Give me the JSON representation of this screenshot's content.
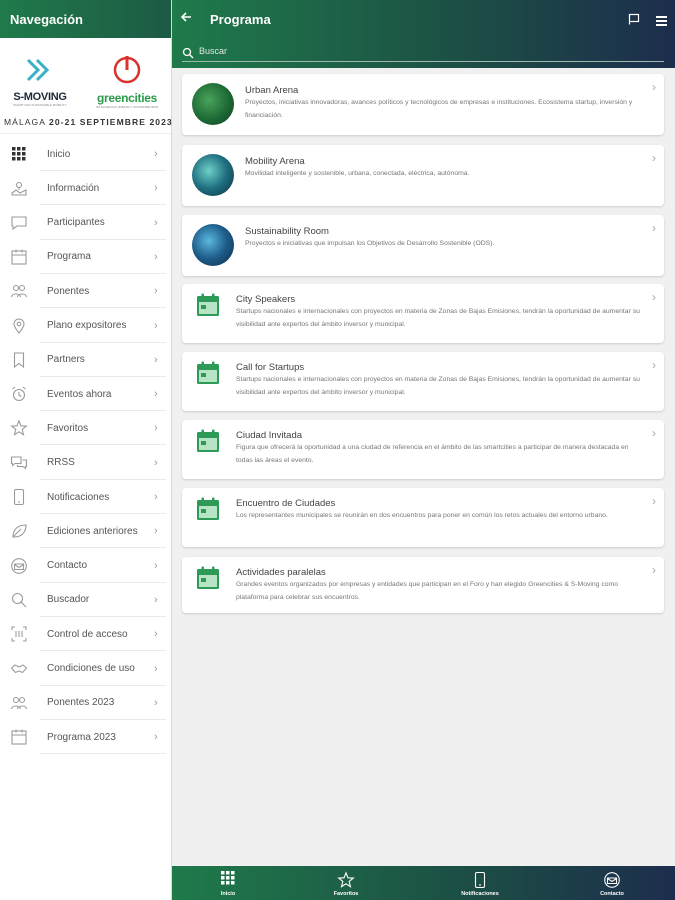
{
  "sidebar": {
    "title": "Navegación",
    "logos": {
      "smoving_name": "S-MOVING",
      "smoving_tagline": "SMART AND SUSTAINABLE MOBILITY",
      "greencities_name": "greencities",
      "greencities_tagline": "INTELIGENCIA URBANA Y SOSTENIBILIDAD",
      "event_city": "MÁLAGA",
      "event_dates": "20-21 SEPTIEMBRE 2023"
    },
    "items": [
      {
        "label": "Inicio",
        "icon": "grid-icon"
      },
      {
        "label": "Información",
        "icon": "map-icon"
      },
      {
        "label": "Participantes",
        "icon": "chat-icon"
      },
      {
        "label": "Programa",
        "icon": "calendar-icon"
      },
      {
        "label": "Ponentes",
        "icon": "people-icon"
      },
      {
        "label": "Plano expositores",
        "icon": "location-pin-icon"
      },
      {
        "label": "Partners",
        "icon": "bookmark-icon"
      },
      {
        "label": "Eventos ahora",
        "icon": "alarm-icon"
      },
      {
        "label": "Favoritos",
        "icon": "star-icon"
      },
      {
        "label": "RRSS",
        "icon": "chats-icon"
      },
      {
        "label": "Notificaciones",
        "icon": "phone-icon"
      },
      {
        "label": "Ediciones anteriores",
        "icon": "leaf-icon"
      },
      {
        "label": "Contacto",
        "icon": "mail-icon"
      },
      {
        "label": "Buscador",
        "icon": "search-icon"
      },
      {
        "label": "Control de acceso",
        "icon": "qr-scan-icon"
      },
      {
        "label": "Condiciones de uso",
        "icon": "handshake-icon"
      },
      {
        "label": "Ponentes 2023",
        "icon": "people-icon"
      },
      {
        "label": "Programa 2023",
        "icon": "calendar-icon"
      }
    ]
  },
  "header": {
    "title": "Programa",
    "search_placeholder": "Buscar"
  },
  "cards": [
    {
      "title": "Urban Arena",
      "description": "Proyectos, iniciativas innovadoras, avances políticos y tecnológicos de empresas e instituciones. Ecosistema startup, inversión y financiación.",
      "thumb": "photo"
    },
    {
      "title": "Mobility Arena",
      "description": "Movilidad inteligente y sostenible, urbana, conectada, eléctrica, autónoma.",
      "thumb": "photo"
    },
    {
      "title": "Sustainability Room",
      "description": "Proyectos e iniciativas que impulsan los Objetivos de Desarrollo Sostenible (ODS).",
      "thumb": "photo"
    },
    {
      "title": "City Speakers",
      "description": "Startups nacionales e internacionales con proyectos en materia de Zonas de Bajas Emisiones, tendrán la oportunidad de aumentar su visibilidad ante expertos del ámbito inversor y municipal.",
      "thumb": "calendar-icon"
    },
    {
      "title": "Call for Startups",
      "description": "Startups nacionales e internacionales con proyectos en materia de Zonas de Bajas Emisiones, tendrán la oportunidad de aumentar su visibilidad ante expertos del ámbito inversor y municipal.",
      "thumb": "calendar-icon"
    },
    {
      "title": "Ciudad Invitada",
      "description": "Figura que ofrecerá la oportunidad a una ciudad de referencia en el ámbito de las smartcities a participar de manera destacada en todas las áreas el evento.",
      "thumb": "calendar-icon"
    },
    {
      "title": "Encuentro de Ciudades",
      "description": "Los representantes municipales se reunirán en dos encuentros para poner en común los retos actuales del entorno urbano.",
      "thumb": "calendar-icon"
    },
    {
      "title": "Actividades paralelas",
      "description": "Grandes eventos organizados por empresas y entidades que participan en el Foro y han elegido Greencities & S-Moving como plataforma para celebrar sus encuentros.",
      "thumb": "calendar-icon"
    }
  ],
  "bottom_nav": [
    {
      "label": "Inicio",
      "icon": "grid-icon"
    },
    {
      "label": "Favoritos",
      "icon": "star-icon"
    },
    {
      "label": "Notificaciones",
      "icon": "phone-icon"
    },
    {
      "label": "Contacto",
      "icon": "mail-icon"
    }
  ],
  "colors": {
    "brand_green": "#1f7a4a",
    "brand_navy": "#1d2d4d",
    "calendar_green": "#2e9a58",
    "greencities_red": "#d9322a"
  }
}
